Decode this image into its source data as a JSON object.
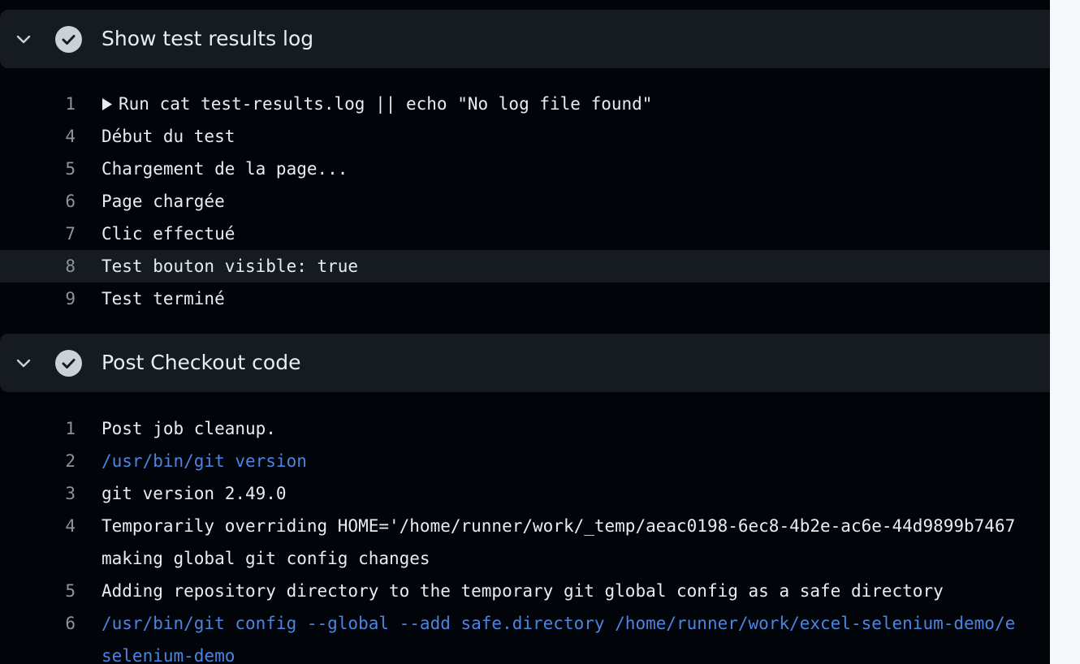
{
  "steps": [
    {
      "title": "Show test results log",
      "status": "success",
      "lines": [
        {
          "no": "1",
          "text": "Run cat test-results.log || echo \"No log file found\"",
          "expandable": true
        },
        {
          "no": "4",
          "text": "Début du test"
        },
        {
          "no": "5",
          "text": "Chargement de la page..."
        },
        {
          "no": "6",
          "text": "Page chargée"
        },
        {
          "no": "7",
          "text": "Clic effectué"
        },
        {
          "no": "8",
          "text": "Test bouton visible: true",
          "highlighted": true
        },
        {
          "no": "9",
          "text": "Test terminé"
        }
      ]
    },
    {
      "title": "Post Checkout code",
      "status": "success",
      "lines": [
        {
          "no": "1",
          "text": "Post job cleanup."
        },
        {
          "no": "2",
          "text": "/usr/bin/git version",
          "command": true
        },
        {
          "no": "3",
          "text": "git version 2.49.0"
        },
        {
          "no": "4",
          "text": "Temporarily overriding HOME='/home/runner/work/_temp/aeac0198-6ec8-4b2e-ac6e-44d9899b7467",
          "continuation": "making global git config changes"
        },
        {
          "no": "5",
          "text": "Adding repository directory to the temporary git global config as a safe directory"
        },
        {
          "no": "6",
          "text": "/usr/bin/git config --global --add safe.directory /home/runner/work/excel-selenium-demo/e",
          "continuation": "selenium-demo",
          "command": true
        }
      ]
    }
  ],
  "icons": {
    "collapse": "chevron-down-icon",
    "status": "check-circle-icon",
    "expand": "triangle-right-icon"
  },
  "colors": {
    "background": "#010409",
    "header": "#161b22",
    "text": "#e6edf3",
    "line_number": "#8b949e",
    "command": "#4c84e0",
    "status_icon": "#c9d1d9"
  }
}
